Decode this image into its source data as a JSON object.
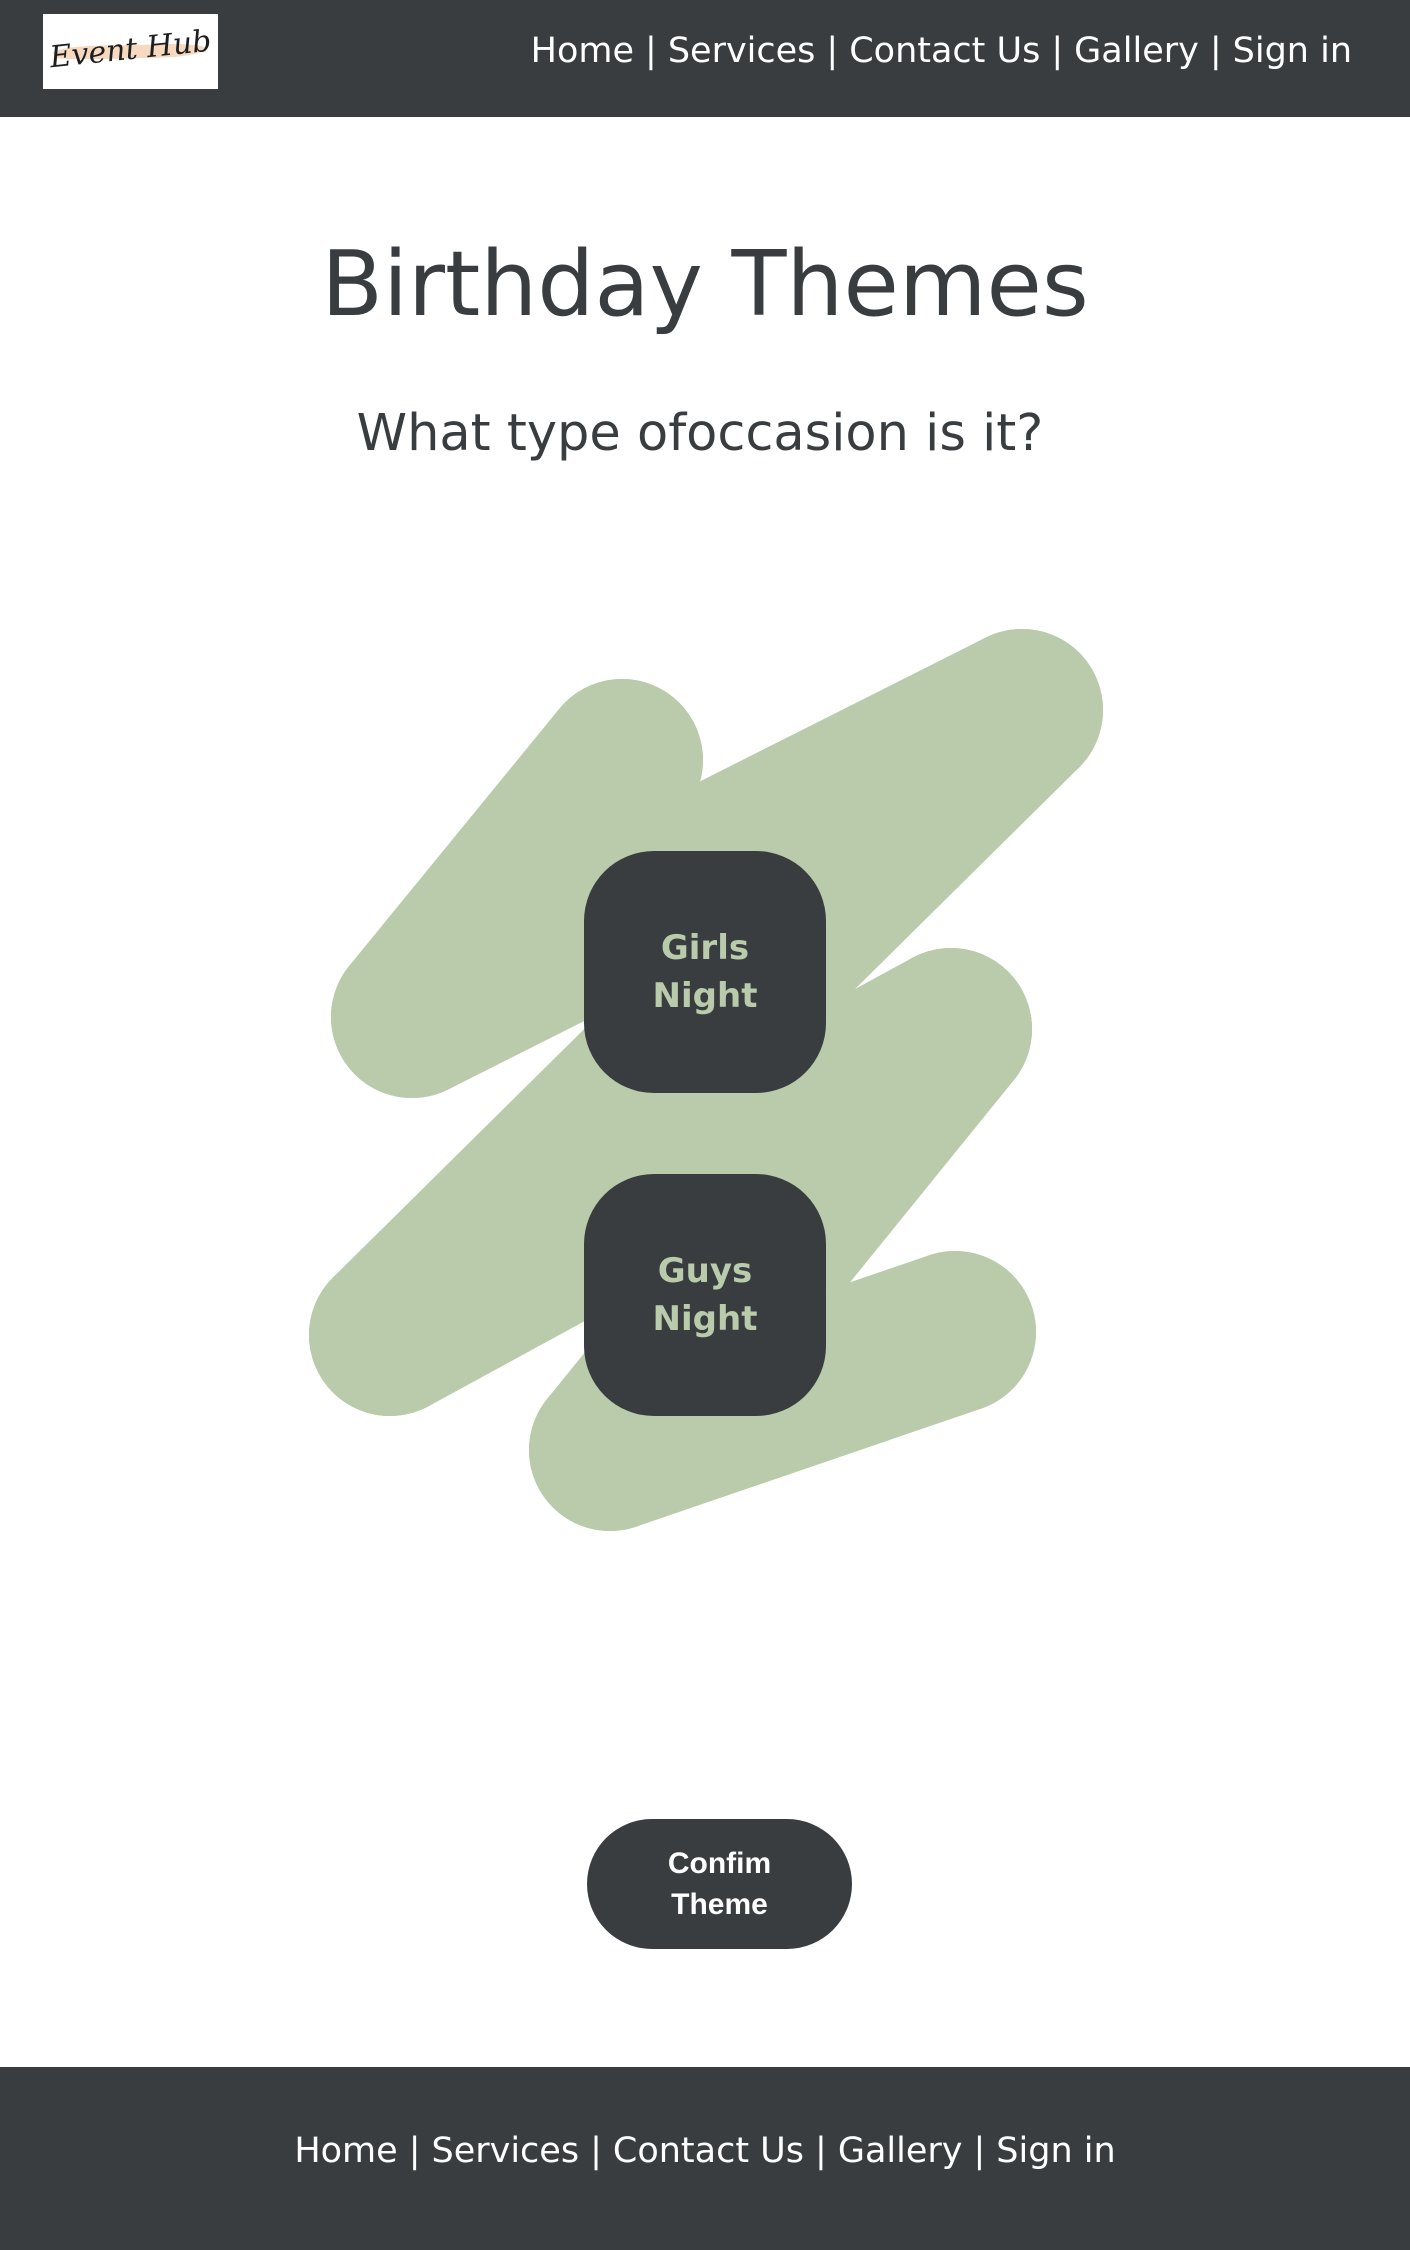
{
  "brand": {
    "logo_text": "Event Hub"
  },
  "nav": {
    "items": [
      {
        "label": "Home"
      },
      {
        "label": "Services"
      },
      {
        "label": "Contact Us"
      },
      {
        "label": "Gallery"
      },
      {
        "label": "Sign in"
      }
    ],
    "separator": "|"
  },
  "main": {
    "title": "Birthday Themes",
    "subtitle": "What type ofoccasion is it?",
    "theme_options": [
      {
        "label": "Girls Night"
      },
      {
        "label": "Guys Night"
      }
    ],
    "confirm_label": "Confim Theme"
  },
  "footer": {
    "items": [
      {
        "label": "Home"
      },
      {
        "label": "Services"
      },
      {
        "label": "Contact Us"
      },
      {
        "label": "Gallery"
      },
      {
        "label": "Sign in"
      }
    ],
    "separator": "|"
  },
  "colors": {
    "dark": "#393d40",
    "sage_green": "#b9cbab",
    "white": "#ffffff",
    "logo_brush": "#f6d9bf"
  }
}
